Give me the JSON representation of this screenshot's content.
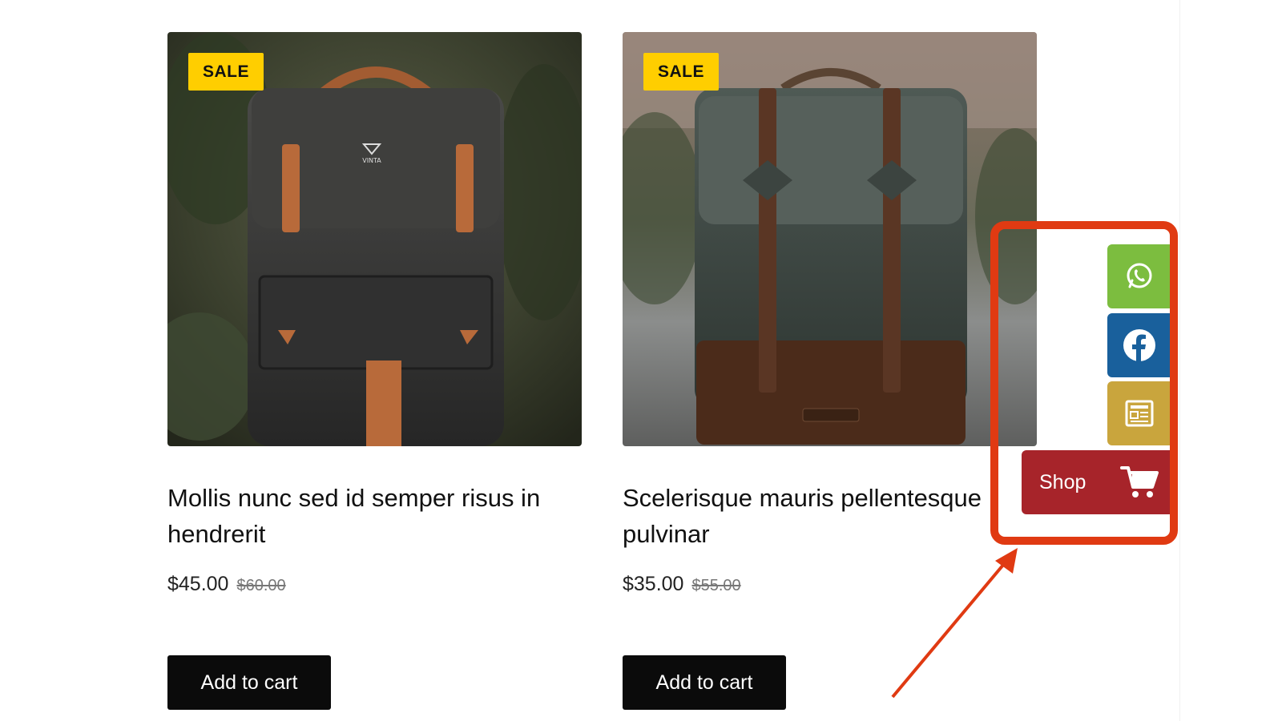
{
  "products": [
    {
      "badge": "SALE",
      "title": "Mollis nunc sed id semper risus in hendrerit",
      "price": "$45.00",
      "old_price": "$60.00",
      "button": "Add to cart",
      "image_logo": "VINTA"
    },
    {
      "badge": "SALE",
      "title": "Scelerisque mauris pellentesque pulvinar",
      "price": "$35.00",
      "old_price": "$55.00",
      "button": "Add to cart"
    }
  ],
  "floating_bar": {
    "whatsapp_icon": "whatsapp-icon",
    "facebook_icon": "facebook-icon",
    "news_icon": "newspaper-icon",
    "shop_label": "Shop",
    "shop_icon": "cart-icon"
  },
  "colors": {
    "sale_badge": "#ffce00",
    "whatsapp": "#7cbd3f",
    "facebook": "#19609c",
    "news": "#c9a53d",
    "shop": "#a7242a",
    "highlight": "#e03a12",
    "button": "#0b0b0b"
  }
}
